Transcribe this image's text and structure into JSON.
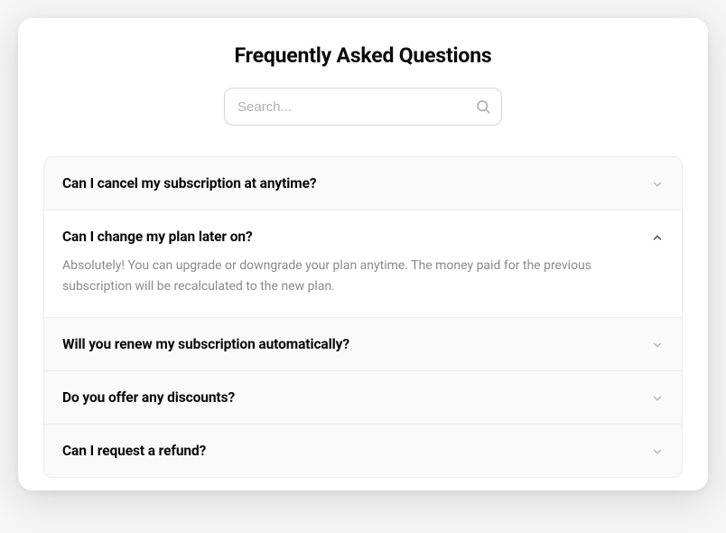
{
  "title": "Frequently Asked Questions",
  "search": {
    "placeholder": "Search..."
  },
  "faq": [
    {
      "question": "Can I cancel my subscription at anytime?",
      "expanded": false
    },
    {
      "question": "Can I change my plan later on?",
      "answer": "Absolutely! You can upgrade or downgrade your plan anytime. The money paid for the previous subscription will be recalculated to the new plan.",
      "expanded": true
    },
    {
      "question": "Will you renew my subscription automatically?",
      "expanded": false
    },
    {
      "question": "Do you offer any discounts?",
      "expanded": false
    },
    {
      "question": "Can I request a refund?",
      "expanded": false
    }
  ]
}
